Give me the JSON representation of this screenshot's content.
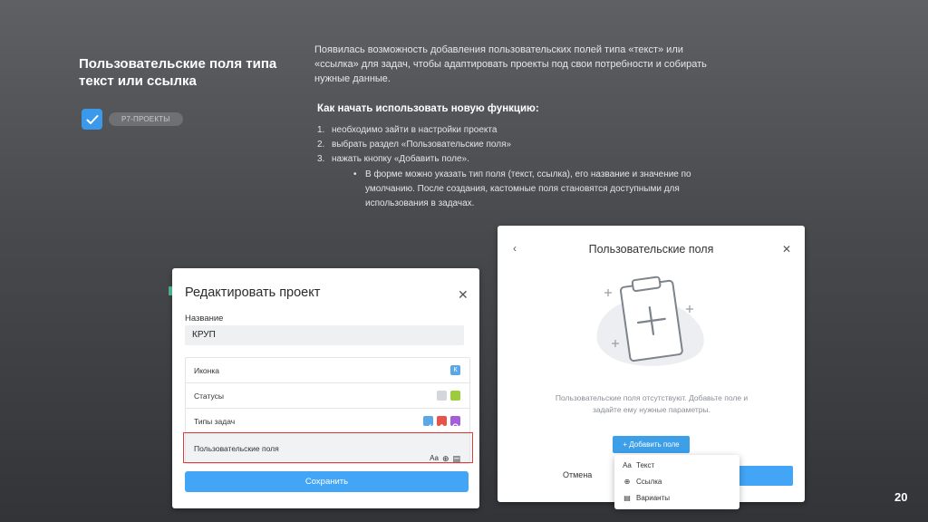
{
  "slide": {
    "title": "Пользовательские поля типа текст или ссылка",
    "badge": "Р7-ПРОЕКТЫ",
    "description": "Появилась возможность добавления пользовательских полей типа «текст» или «ссылка» для задач, чтобы адаптировать проекты под свои потребности и собирать нужные данные.",
    "howto_title": "Как начать использовать новую функцию:",
    "steps": [
      {
        "num": "1.",
        "text": "необходимо зайти в настройки проекта"
      },
      {
        "num": "2.",
        "text": "выбрать раздел «Пользовательские поля»"
      },
      {
        "num": "3.",
        "text": "нажать кнопку «Добавить поле»."
      }
    ],
    "subnote": "В форме можно указать тип поля (текст, ссылка), его название и значение по умолчанию. После создания, кастомные поля становятся доступными для использования в задачах.",
    "page_number": "20"
  },
  "edit_project": {
    "title": "Редактировать проект",
    "name_label": "Название",
    "name_value": "КРУП",
    "rows": [
      {
        "label": "Иконка"
      },
      {
        "label": "Статусы"
      },
      {
        "label": "Типы задач"
      },
      {
        "label": "Пользовательские поля"
      }
    ],
    "icon_letter": "К",
    "save_label": "Сохранить",
    "colors": {
      "accent": "#42a5f5",
      "highlight": "#e53935",
      "status_gray": "#d3d6db",
      "status_green": "#9ccc3d",
      "type_blue": "#5aa9e6",
      "type_red": "#e5534b",
      "type_purple": "#a35fd9"
    }
  },
  "custom_fields": {
    "title": "Пользовательские поля",
    "empty_text": "Пользовательские поля отсутствуют. Добавьте поле и задайте ему нужные параметры.",
    "add_label": "Добавить поле",
    "cancel_label": "Отмена",
    "menu": [
      {
        "icon": "text-type-icon",
        "glyph": "Aa",
        "label": "Текст"
      },
      {
        "icon": "globe-icon",
        "glyph": "⊕",
        "label": "Ссылка"
      },
      {
        "icon": "archive-icon",
        "glyph": "▤",
        "label": "Варианты"
      }
    ]
  }
}
